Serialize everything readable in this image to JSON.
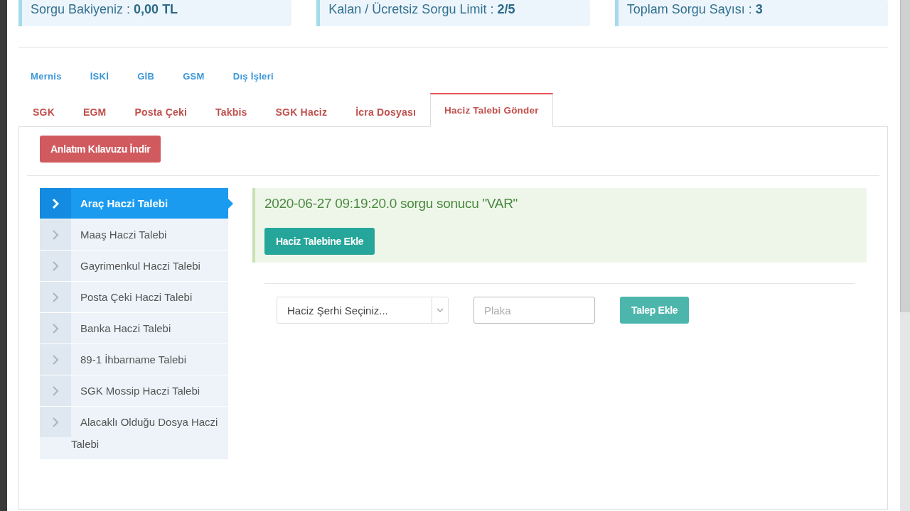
{
  "stats": [
    {
      "label": "Sorgu Bakiyeniz :",
      "value": "0,00 TL"
    },
    {
      "label": "Kalan / Ücretsiz Sorgu Limit :",
      "value": "2/5"
    },
    {
      "label": "Toplam Sorgu Sayısı :",
      "value": "3"
    }
  ],
  "query_tabs": [
    {
      "label": "Mernis"
    },
    {
      "label": "İSKİ"
    },
    {
      "label": "GİB"
    },
    {
      "label": "GSM"
    },
    {
      "label": "Dış İşleri"
    }
  ],
  "tabs": [
    {
      "label": "SGK",
      "selected": false
    },
    {
      "label": "EGM",
      "selected": false
    },
    {
      "label": "Posta Çeki",
      "selected": false
    },
    {
      "label": "Takbis",
      "selected": false
    },
    {
      "label": "SGK Haciz",
      "selected": false
    },
    {
      "label": "İcra Dosyası",
      "selected": false
    },
    {
      "label": "Haciz Talebi Gönder",
      "selected": true
    }
  ],
  "guide_button": "Anlatım Kılavuzu İndir",
  "sidebar": {
    "items": [
      {
        "label": "Araç Haczi Talebi",
        "selected": true
      },
      {
        "label": "Maaş Haczi Talebi",
        "selected": false
      },
      {
        "label": "Gayrimenkul Haczi Talebi",
        "selected": false
      },
      {
        "label": "Posta Çeki Haczi Talebi",
        "selected": false
      },
      {
        "label": "Banka Haczi Talebi",
        "selected": false
      },
      {
        "label": "89-1 İhbarname Talebi",
        "selected": false
      },
      {
        "label": "SGK Mossip Haczi Talebi",
        "selected": false
      },
      {
        "label": "Alacaklı Olduğu Dosya Haczi Talebi",
        "selected": false
      }
    ]
  },
  "result": {
    "message": "2020-06-27 09:19:20.0 sorgu sonucu \"VAR\"",
    "button": "Haciz Talebine Ekle"
  },
  "form": {
    "select_value": "Haciz Şerhi Seçiniz...",
    "plate_placeholder": "Plaka",
    "add_button": "Talep Ekle"
  }
}
